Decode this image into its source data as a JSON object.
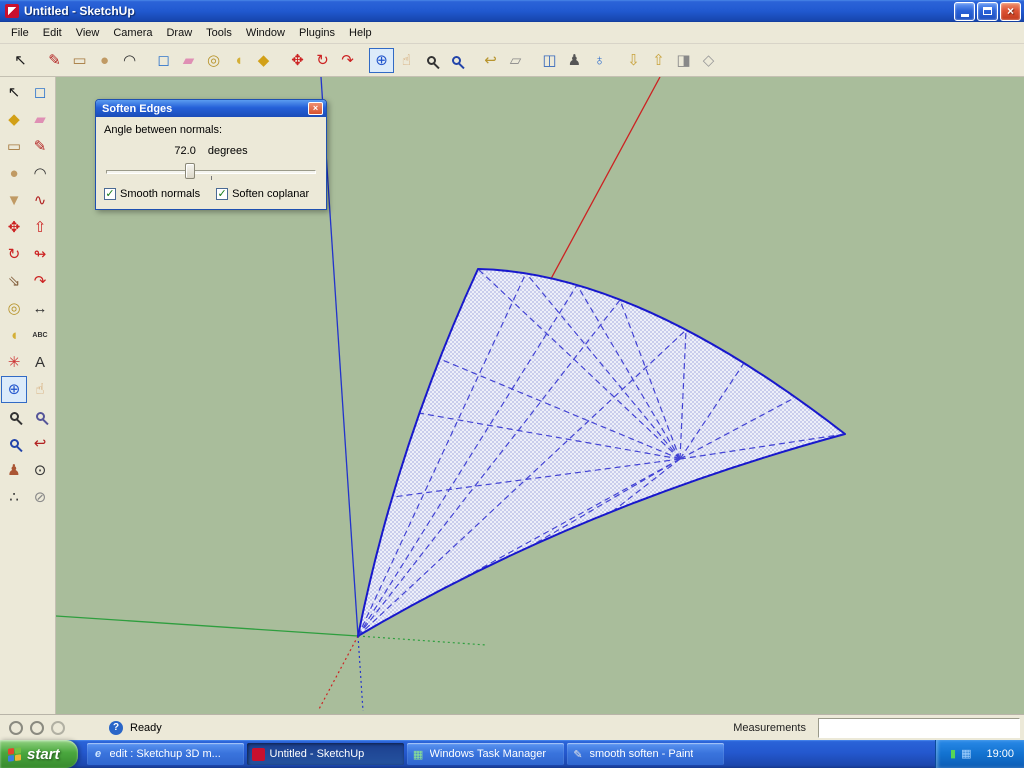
{
  "titlebar": {
    "title": "Untitled - SketchUp"
  },
  "menubar": {
    "items": [
      "File",
      "Edit",
      "View",
      "Camera",
      "Draw",
      "Tools",
      "Window",
      "Plugins",
      "Help"
    ]
  },
  "toolbar": {
    "buttons": [
      {
        "name": "select",
        "glyph": "↖",
        "color": "#1a1a1a"
      },
      {
        "name": "line",
        "glyph": "✎",
        "color": "#b22222",
        "gap": true
      },
      {
        "name": "rectangle",
        "glyph": "▭",
        "color": "#a5783c"
      },
      {
        "name": "circle",
        "glyph": "●",
        "color": "#c09a64"
      },
      {
        "name": "arc",
        "glyph": "◠",
        "color": "#333333"
      },
      {
        "name": "push-pull",
        "glyph": "◻",
        "color": "#3377cc",
        "gap": true
      },
      {
        "name": "eraser",
        "glyph": "▰",
        "color": "#df8fb4"
      },
      {
        "name": "tape-measure",
        "glyph": "◎",
        "color": "#b8952e"
      },
      {
        "name": "protractor",
        "glyph": "◖",
        "color": "#d4af37"
      },
      {
        "name": "paint-bucket",
        "glyph": "◆",
        "color": "#d2a017"
      },
      {
        "name": "move",
        "glyph": "✥",
        "color": "#cc2222",
        "gap": true
      },
      {
        "name": "rotate",
        "glyph": "↻",
        "color": "#cc2222"
      },
      {
        "name": "offset",
        "glyph": "↷",
        "color": "#cc2222"
      },
      {
        "name": "orbit",
        "glyph": "⊕",
        "color": "#2255cc",
        "gap": true,
        "active": true
      },
      {
        "name": "pan",
        "glyph": "☝",
        "color": "#cf9a5f"
      },
      {
        "name": "zoom",
        "glyph": "MAG",
        "color": "#333333"
      },
      {
        "name": "zoom-extents",
        "glyph": "MAG",
        "color": "#2244aa"
      },
      {
        "name": "previous-view",
        "glyph": "↩",
        "color": "#b8952e",
        "gap": true
      },
      {
        "name": "face-style",
        "glyph": "▱",
        "color": "#888888"
      },
      {
        "name": "component-browser",
        "glyph": "◫",
        "color": "#3366bb",
        "gap": true
      },
      {
        "name": "position-person",
        "glyph": "♟",
        "color": "#555555"
      },
      {
        "name": "web-browser",
        "glyph": "♁",
        "color": "#2266cc"
      },
      {
        "name": "get-models",
        "glyph": "⇩",
        "color": "#c8a23c",
        "gap": true
      },
      {
        "name": "upload-model",
        "glyph": "⇧",
        "color": "#c8a23c"
      },
      {
        "name": "model-box",
        "glyph": "◨",
        "color": "#888888"
      },
      {
        "name": "warehouse",
        "glyph": "◇",
        "color": "#999999"
      }
    ]
  },
  "left_toolbar": {
    "buttons": [
      {
        "name": "select",
        "glyph": "↖",
        "color": "#1a1a1a"
      },
      {
        "name": "make-component",
        "glyph": "◻",
        "color": "#3377cc"
      },
      {
        "name": "paint-bucket",
        "glyph": "◆",
        "color": "#d2a017"
      },
      {
        "name": "eraser",
        "glyph": "▰",
        "color": "#df8fb4"
      },
      {
        "name": "rectangle",
        "glyph": "▭",
        "color": "#a5783c"
      },
      {
        "name": "line",
        "glyph": "✎",
        "color": "#b22222"
      },
      {
        "name": "circle",
        "glyph": "●",
        "color": "#c09a64"
      },
      {
        "name": "arc",
        "glyph": "◠",
        "color": "#333333"
      },
      {
        "name": "polygon",
        "glyph": "▼",
        "color": "#c09a64"
      },
      {
        "name": "freehand",
        "glyph": "∿",
        "color": "#b22222"
      },
      {
        "name": "move",
        "glyph": "✥",
        "color": "#cc2222"
      },
      {
        "name": "push-pull",
        "glyph": "⇧",
        "color": "#cc2222"
      },
      {
        "name": "rotate",
        "glyph": "↻",
        "color": "#cc2222"
      },
      {
        "name": "follow-me",
        "glyph": "↬",
        "color": "#cc2222"
      },
      {
        "name": "scale",
        "glyph": "⇘",
        "color": "#886644"
      },
      {
        "name": "offset",
        "glyph": "↷",
        "color": "#cc2222"
      },
      {
        "name": "tape-measure",
        "glyph": "◎",
        "color": "#b8952e"
      },
      {
        "name": "dimension",
        "glyph": "↔",
        "color": "#333333"
      },
      {
        "name": "protractor",
        "glyph": "◖",
        "color": "#d4af37"
      },
      {
        "name": "text",
        "glyph": "ABC",
        "color": "#333333"
      },
      {
        "name": "axes",
        "glyph": "✳",
        "color": "#cc3333"
      },
      {
        "name": "text-3d",
        "glyph": "A",
        "color": "#333333"
      },
      {
        "name": "orbit",
        "glyph": "⊕",
        "color": "#2255cc",
        "active": true
      },
      {
        "name": "pan",
        "glyph": "☝",
        "color": "#cf9a5f"
      },
      {
        "name": "zoom",
        "glyph": "MAG",
        "color": "#333333"
      },
      {
        "name": "zoom-window",
        "glyph": "MAG",
        "color": "#555599"
      },
      {
        "name": "zoom-extents",
        "glyph": "MAG",
        "color": "#2244aa"
      },
      {
        "name": "previous-view",
        "glyph": "↩",
        "color": "#b22222"
      },
      {
        "name": "position-camera",
        "glyph": "♟",
        "color": "#aa5533"
      },
      {
        "name": "look-around",
        "glyph": "⊙",
        "color": "#333333"
      },
      {
        "name": "walk",
        "glyph": "∴",
        "color": "#333333"
      },
      {
        "name": "section-plane",
        "glyph": "⊘",
        "color": "#888888"
      }
    ]
  },
  "viewport": {
    "background": "#a9bd9b",
    "face_fill": "#edeff9",
    "edge_color": "#1818cc",
    "axis_red": "#cc2222",
    "axis_green": "#2e9e3e",
    "axis_blue": "#2233cc"
  },
  "dialog": {
    "title": "Soften Edges",
    "angle_label": "Angle between normals:",
    "angle_value": "72.0",
    "angle_unit": "degrees",
    "slider_percent": 40,
    "checkboxes": [
      {
        "label": "Smooth normals",
        "checked": true
      },
      {
        "label": "Soften coplanar",
        "checked": true
      }
    ]
  },
  "statusbar": {
    "ready": "Ready",
    "measurements_label": "Measurements",
    "measurements_value": ""
  },
  "taskbar": {
    "start_label": "start",
    "clock": "19:00",
    "tasks": [
      {
        "label": "edit : Sketchup 3D m...",
        "active": false,
        "icon": {
          "name": "internet-explorer",
          "glyph": "e",
          "bg": "transparent",
          "color": "#cfe6ff"
        }
      },
      {
        "label": "Untitled - SketchUp",
        "active": true,
        "icon": {
          "name": "sketchup",
          "glyph": "",
          "bg": "#c8102e",
          "color": "#ffffff"
        }
      },
      {
        "label": "Windows Task Manager",
        "active": false,
        "icon": {
          "name": "task-manager",
          "glyph": "▦",
          "bg": "transparent",
          "color": "#8fe88f"
        }
      },
      {
        "label": "smooth soften - Paint",
        "active": false,
        "icon": {
          "name": "paint",
          "glyph": "✎",
          "bg": "transparent",
          "color": "#e8e8e8"
        }
      }
    ],
    "tray_icons": [
      {
        "name": "safety",
        "glyph": "▮",
        "color": "#57d657"
      },
      {
        "name": "network",
        "glyph": "▦",
        "color": "#a8d4ff"
      }
    ]
  }
}
